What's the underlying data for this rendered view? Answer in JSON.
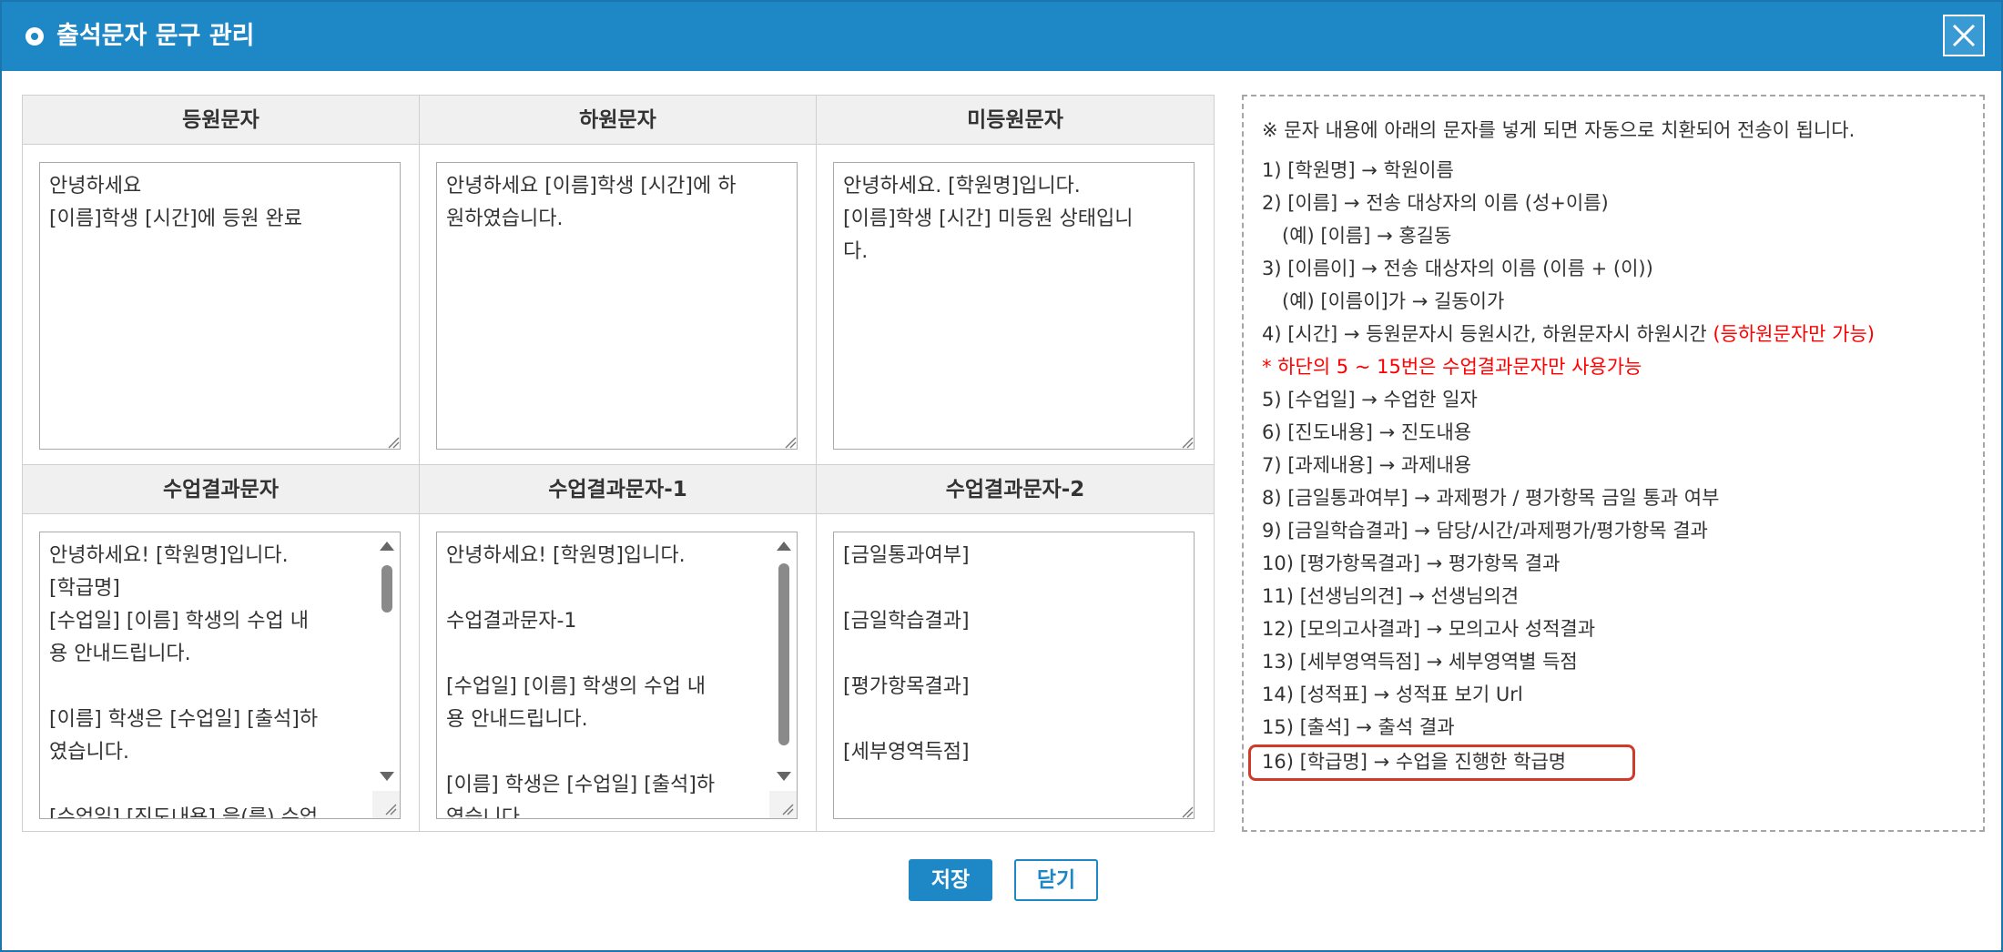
{
  "dialog": {
    "title": "출석문자 문구 관리",
    "close_icon": "close-icon"
  },
  "columns": {
    "checkin": "등원문자",
    "checkout": "하원문자",
    "absent": "미등원문자",
    "result": "수업결과문자",
    "result1": "수업결과문자-1",
    "result2": "수업결과문자-2"
  },
  "textareas": {
    "checkin": "안녕하세요\n[이름]학생 [시간]에 등원 완료",
    "checkout": "안녕하세요 [이름]학생 [시간]에 하\n원하였습니다.",
    "absent": "안녕하세요. [학원명]입니다.\n[이름]학생 [시간] 미등원 상태입니\n다.",
    "result": "안녕하세요! [학원명]입니다.\n[학급명]\n[수업일] [이름] 학생의 수업 내\n용 안내드립니다.\n\n[이름] 학생은 [수업일] [출석]하\n였습니다.\n\n[수업일] [진도내용] 을(를) 수업",
    "result1": "안녕하세요! [학원명]입니다.\n\n수업결과문자-1\n\n[수업일] [이름] 학생의 수업 내\n용 안내드립니다.\n\n[이름] 학생은 [수업일] [출석]하\n였습니다.",
    "result2": "[금일통과여부]\n\n[금일학습결과]\n\n[평가항목결과]\n\n[세부영역득점]"
  },
  "help": {
    "intro": "※ 문자 내용에 아래의 문자를 넣게 되면 자동으로 치환되어 전송이 됩니다.",
    "l1": "1) [학원명] → 학원이름",
    "l2": "2) [이름] → 전송 대상자의 이름 (성+이름)",
    "l2ex": "(예) [이름] → 홍길동",
    "l3": "3) [이름이] → 전송 대상자의 이름 (이름 + (이))",
    "l3ex": "(예) [이름이]가 → 길동이가",
    "l4": "4) [시간] → 등원문자시 등원시간, 하원문자시 하원시간 ",
    "l4red": "(등하원문자만 가능)",
    "note": "* 하단의 5 ~ 15번은 수업결과문자만 사용가능",
    "l5": "5) [수업일] → 수업한 일자",
    "l6": "6) [진도내용] → 진도내용",
    "l7": "7) [과제내용] → 과제내용",
    "l8": "8) [금일통과여부] → 과제평가 / 평가항목 금일 통과 여부",
    "l9": "9) [금일학습결과] → 담당/시간/과제평가/평가항목 결과",
    "l10": "10) [평가항목결과] → 평가항목 결과",
    "l11": "11) [선생님의견] → 선생님의견",
    "l12": "12) [모의고사결과] → 모의고사 성적결과",
    "l13": "13) [세부영역득점] → 세부영역별 득점",
    "l14": "14) [성적표] → 성적표 보기 Url",
    "l15": "15) [출석] → 출석 결과",
    "l16": "16) [학급명] → 수업을 진행한 학급명"
  },
  "buttons": {
    "save": "저장",
    "close": "닫기"
  },
  "colors": {
    "header_blue": "#1e88c6",
    "highlight_red": "#d03a2a",
    "warning_red": "#ff0000"
  }
}
